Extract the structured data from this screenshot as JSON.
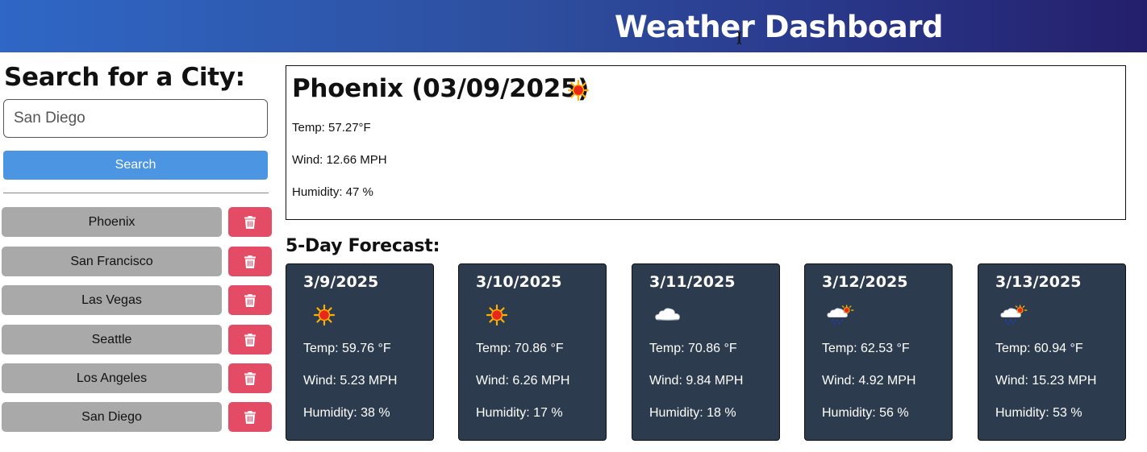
{
  "header": {
    "title": "Weather Dashboard"
  },
  "search": {
    "title": "Search for a City:",
    "input_value": "San Diego",
    "button_label": "Search"
  },
  "history": [
    {
      "city": "Phoenix"
    },
    {
      "city": "San Francisco"
    },
    {
      "city": "Las Vegas"
    },
    {
      "city": "Seattle"
    },
    {
      "city": "Los Angeles"
    },
    {
      "city": "San Diego"
    }
  ],
  "current": {
    "title": "Phoenix (03/09/2025)",
    "icon": "sun-icon",
    "temp": "Temp: 57.27°F",
    "wind": "Wind: 12.66 MPH",
    "humidity": "Humidity: 47 %"
  },
  "forecast_title": "5-Day Forecast:",
  "forecast": [
    {
      "date": "3/9/2025",
      "icon": "sun-icon",
      "temp": "Temp: 59.76 °F",
      "wind": "Wind: 5.23 MPH",
      "humidity": "Humidity: 38 %"
    },
    {
      "date": "3/10/2025",
      "icon": "sun-icon",
      "temp": "Temp: 70.86 °F",
      "wind": "Wind: 6.26 MPH",
      "humidity": "Humidity: 17 %"
    },
    {
      "date": "3/11/2025",
      "icon": "cloud-icon",
      "temp": "Temp: 70.86 °F",
      "wind": "Wind: 9.84 MPH",
      "humidity": "Humidity: 18 %"
    },
    {
      "date": "3/12/2025",
      "icon": "rain-icon",
      "temp": "Temp: 62.53 °F",
      "wind": "Wind: 4.92 MPH",
      "humidity": "Humidity: 56 %"
    },
    {
      "date": "3/13/2025",
      "icon": "rain-icon",
      "temp": "Temp: 60.94 °F",
      "wind": "Wind: 15.23 MPH",
      "humidity": "Humidity: 53 %"
    }
  ],
  "colors": {
    "search_button": "#4c95e3",
    "delete_button": "#e44c66",
    "city_button": "#a9a9a9",
    "forecast_card": "#2c3b4d"
  }
}
